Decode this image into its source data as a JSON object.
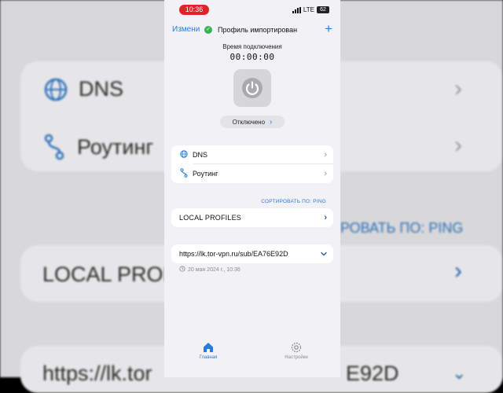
{
  "status_bar": {
    "time": "10:36",
    "network": "LTE",
    "battery": "62"
  },
  "header": {
    "edit_label": "Измени",
    "imported_text": "Профиль импортирован",
    "add_label": "+"
  },
  "connection": {
    "label": "Время подключения",
    "timer": "00:00:00",
    "status": "Отключено"
  },
  "menu": {
    "items": [
      {
        "label": "DNS",
        "icon": "globe-icon"
      },
      {
        "label": "Роутинг",
        "icon": "route-icon"
      }
    ]
  },
  "profiles": {
    "sort_label": "СОРТИРОВАТЬ ПО: PING",
    "local_label": "LOCAL PROFILES",
    "subscription_url": "https://lk.tor-vpn.ru/sub/EA76E92D",
    "updated": "20 мая 2024 г., 10:36"
  },
  "tabbar": {
    "home_label": "Главная",
    "settings_label": "Настройки"
  },
  "background": {
    "dns": "DNS",
    "routing": "Роутинг",
    "sort_partial": "РОВАТЬ ПО: PING",
    "local_partial": "LOCAL PROF",
    "url_partial_left": "https://lk.tor",
    "url_partial_right": "E92D"
  },
  "colors": {
    "accent": "#2a7ad8",
    "success": "#34b552",
    "recording": "#e0232a"
  }
}
